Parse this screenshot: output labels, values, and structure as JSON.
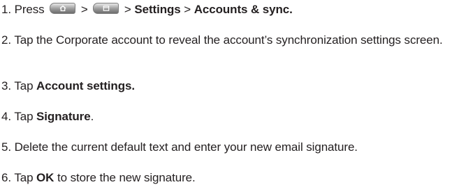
{
  "steps": [
    {
      "number": "1.",
      "press_word": "Press",
      "icons": [
        "home-key-icon",
        "menu-key-icon"
      ],
      "sep1": ">",
      "sep2": ">",
      "settings": "Settings",
      "sep3": ">",
      "accounts": "Accounts & sync."
    },
    {
      "number": "2.",
      "text": "Tap the Corporate account to reveal the account’s synchronization settings screen."
    },
    {
      "number": "3.",
      "pre": "Tap",
      "bold": "Account settings."
    },
    {
      "number": "4.",
      "pre": "Tap",
      "bold": "Signature",
      "post": "."
    },
    {
      "number": "5.",
      "text": "Delete the current default text and enter your new email signature."
    },
    {
      "number": "6.",
      "pre": "Tap",
      "bold": "OK",
      "post": "to store the new signature."
    }
  ]
}
